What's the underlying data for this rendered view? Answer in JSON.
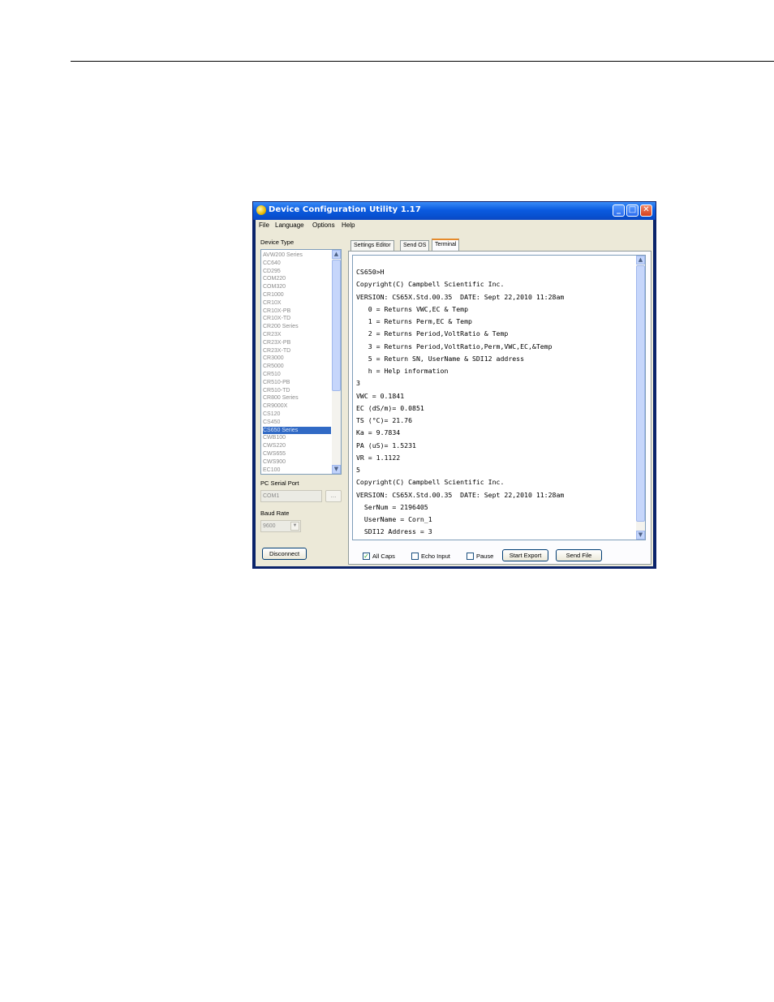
{
  "window": {
    "title": "Device Configuration Utility 1.17",
    "minimize_glyph": "_",
    "maximize_glyph": "□",
    "close_glyph": "✕"
  },
  "menu": [
    "File",
    "Language",
    "Options",
    "Help"
  ],
  "left": {
    "device_type_label": "Device Type",
    "devices": [
      "AVW200 Series",
      "CC640",
      "CD295",
      "COM220",
      "COM320",
      "CR1000",
      "CR10X",
      "CR10X-PB",
      "CR10X-TD",
      "CR200 Series",
      "CR23X",
      "CR23X-PB",
      "CR23X-TD",
      "CR3000",
      "CR5000",
      "CR510",
      "CR510-PB",
      "CR510-TD",
      "CR800 Series",
      "CR9000X",
      "CS120",
      "CS450",
      "CS650 Series",
      "CWB100",
      "CWS220",
      "CWS655",
      "CWS900",
      "EC100"
    ],
    "selected_device": "CS650 Series",
    "serial_port_label": "PC Serial Port",
    "serial_port_value": "COM1",
    "browse_label": "...",
    "baud_rate_label": "Baud Rate",
    "baud_rate_value": "9600",
    "disconnect_label": "Disconnect"
  },
  "tabs": [
    "Settings Editor",
    "Send OS",
    "Terminal"
  ],
  "active_tab": "Terminal",
  "terminal": {
    "lines": [
      "CS650>H",
      "Copyright(C) Campbell Scientific Inc.",
      "VERSION: CS65X.Std.00.35  DATE: Sept 22,2010 11:28am",
      "   0 = Returns VWC,EC & Temp",
      "   1 = Returns Perm,EC & Temp",
      "   2 = Returns Period,VoltRatio & Temp",
      "   3 = Returns Period,VoltRatio,Perm,VWC,EC,&Temp",
      "   5 = Return SN, UserName & SDI12 address",
      "   h = Help information",
      "3",
      "VWC = 0.1841",
      "EC (dS/m)= 0.0851",
      "TS (°C)= 21.76",
      "Ka = 9.7834",
      "PA (uS)= 1.5231",
      "VR = 1.1122",
      "5",
      "Copyright(C) Campbell Scientific Inc.",
      "VERSION: CS65X.Std.00.35  DATE: Sept 22,2010 11:28am",
      "  SerNum = 2196405",
      "  UserName = Corn_1",
      "  SDI12 Address = 3"
    ]
  },
  "controls": {
    "all_caps_label": "All Caps",
    "all_caps_checked": true,
    "echo_input_label": "Echo Input",
    "echo_input_checked": false,
    "pause_label": "Pause",
    "pause_checked": false,
    "start_export_label": "Start Export",
    "send_file_label": "Send File"
  },
  "colors": {
    "titlebar": "#0b5be0",
    "selection": "#316ac5",
    "active_tab_accent": "#e68b2c"
  }
}
